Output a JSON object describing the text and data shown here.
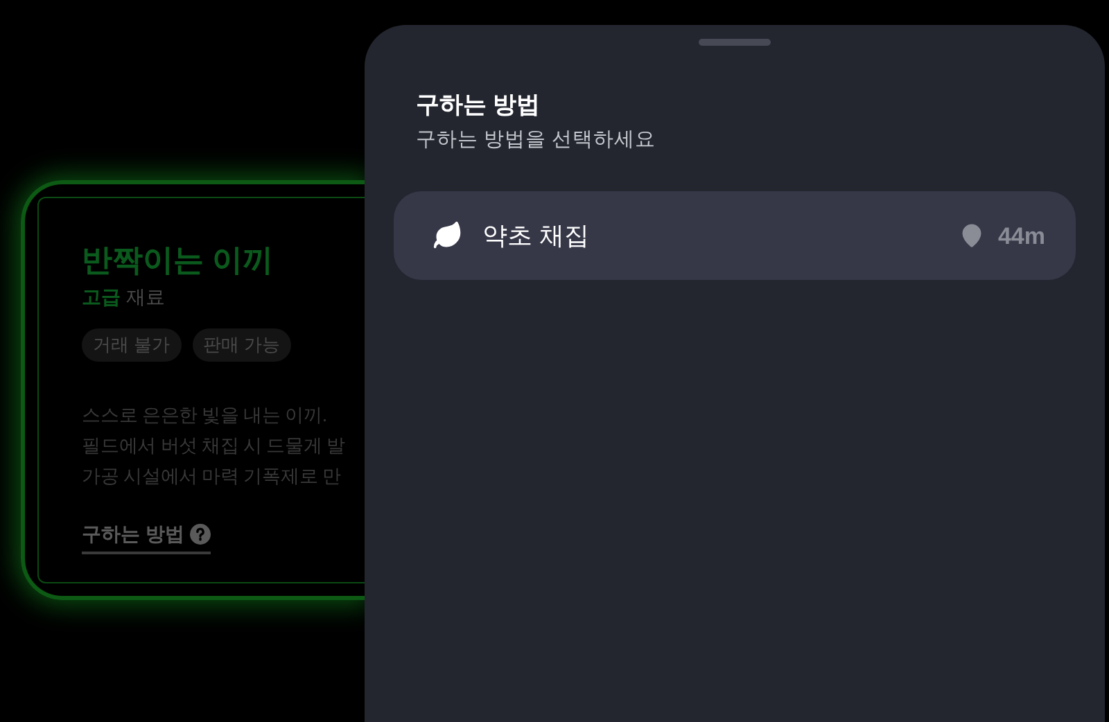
{
  "item_card": {
    "title": "반짝이는 이끼",
    "grade": "고급",
    "category": "재료",
    "tags": [
      "거래 불가",
      "판매 가능"
    ],
    "description": [
      "스스로 은은한 빛을 내는 이끼.",
      "필드에서 버섯 채집 시 드물게 발",
      "가공 시설에서 마력 기폭제로 만"
    ],
    "how_to_get_link": "구하는 방법"
  },
  "sheet": {
    "title": "구하는 방법",
    "subtitle": "구하는 방법을 선택하세요",
    "options": [
      {
        "label": "약초 채집",
        "distance": "44m"
      }
    ]
  }
}
